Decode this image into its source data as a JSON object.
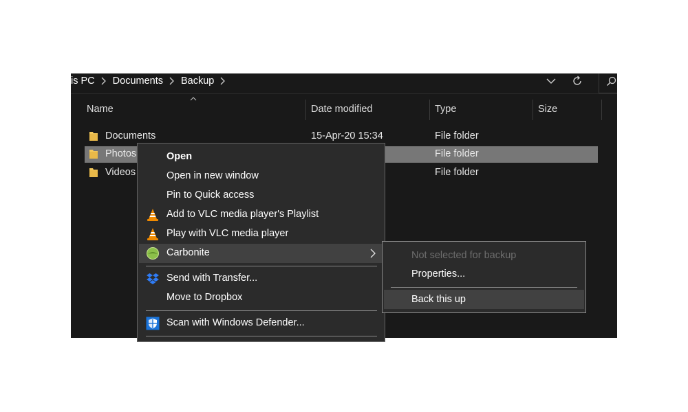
{
  "address": {
    "breadcrumbs": [
      "is PC",
      "Documents",
      "Backup"
    ],
    "dropdown_icon": "chevron-down-icon",
    "refresh_icon": "refresh-icon"
  },
  "columns": [
    "Name",
    "Date modified",
    "Type",
    "Size"
  ],
  "rows": [
    {
      "name": "Documents",
      "date": "15-Apr-20 15:34",
      "type": "File folder",
      "size": ""
    },
    {
      "name": "Photos",
      "date": "",
      "type": "File folder",
      "size": ""
    },
    {
      "name": "Videos",
      "date": "",
      "type": "File folder",
      "size": ""
    }
  ],
  "context_menu": {
    "items": [
      {
        "label": "Open",
        "icon": ""
      },
      {
        "label": "Open in new window",
        "icon": ""
      },
      {
        "label": "Pin to Quick access",
        "icon": ""
      },
      {
        "label": "Add to VLC media player's Playlist",
        "icon": "vlc-icon"
      },
      {
        "label": "Play with VLC media player",
        "icon": "vlc-icon"
      },
      {
        "label": "Carbonite",
        "icon": "carbonite-icon"
      },
      {
        "label": "Send with Transfer...",
        "icon": "dropbox-icon"
      },
      {
        "label": "Move to Dropbox",
        "icon": ""
      },
      {
        "label": "Scan with Windows Defender...",
        "icon": "defender-icon"
      }
    ]
  },
  "submenu": {
    "items": [
      {
        "label": "Not selected for backup",
        "disabled": true
      },
      {
        "label": "Properties...",
        "disabled": false
      },
      {
        "label": "Back this up",
        "disabled": false
      }
    ]
  },
  "colors": {
    "background": "#191919",
    "menu_bg": "#2b2b2b",
    "selected_row": "#777777",
    "hover": "#414141",
    "folder": "#f2c85b",
    "vlc_orange": "#f08a00",
    "carbonite_green": "#8cc04a",
    "dropbox_blue": "#2f7cf6",
    "defender_blue": "#1a73d9"
  }
}
